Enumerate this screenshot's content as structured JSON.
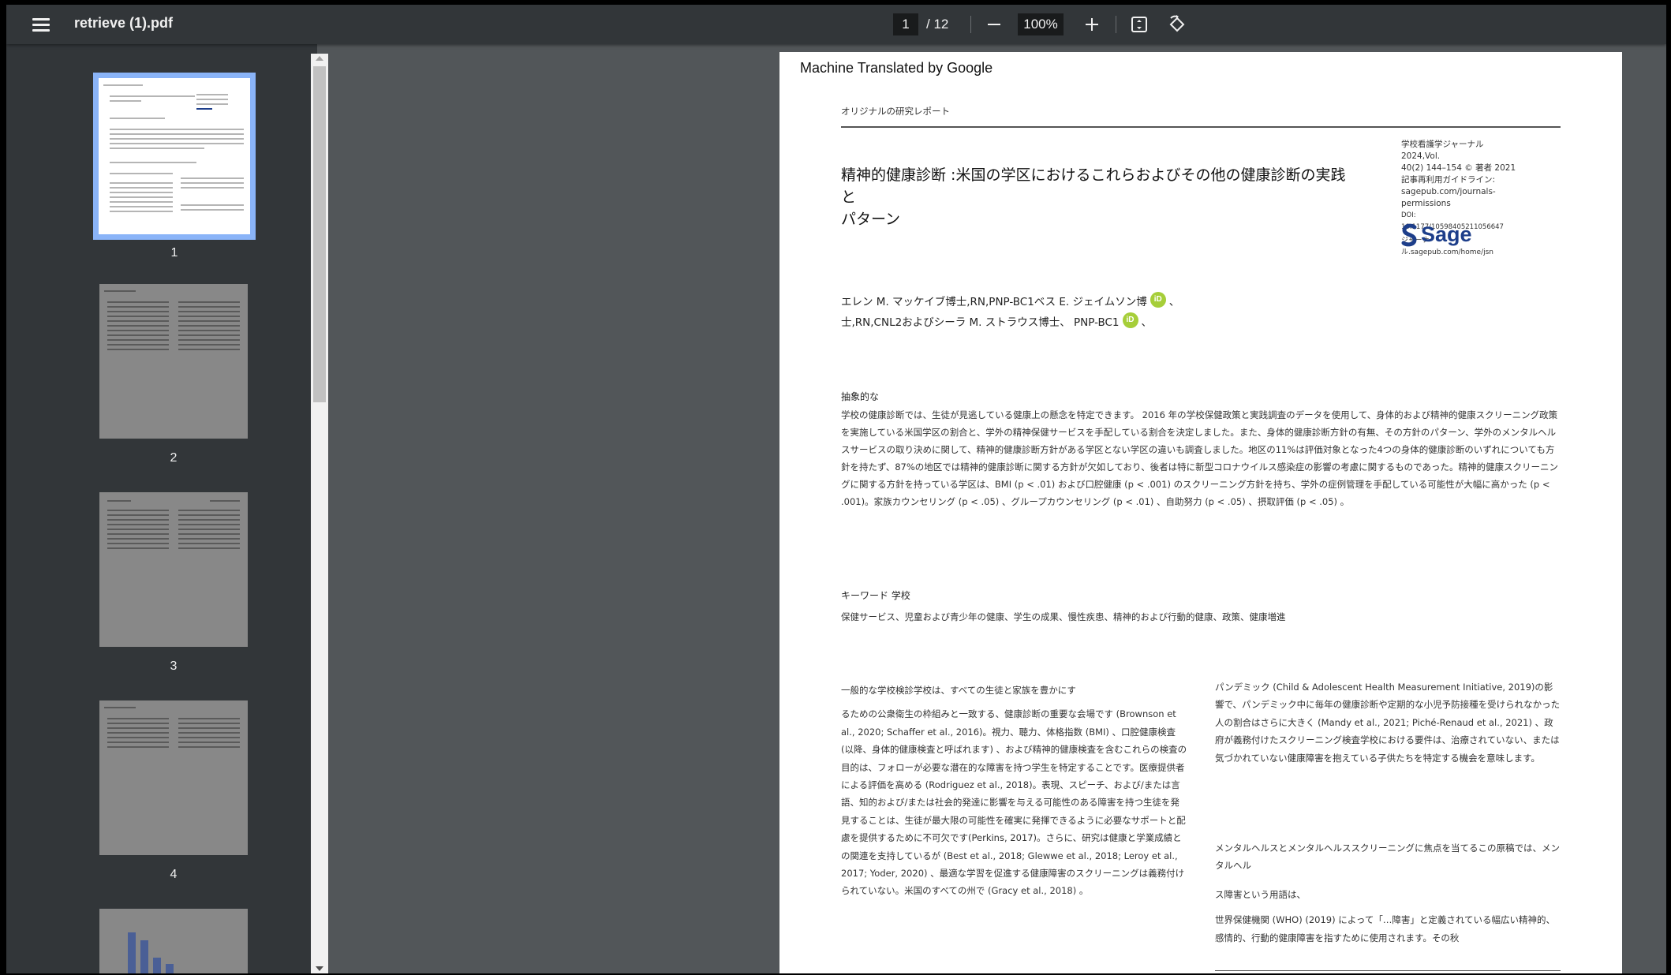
{
  "app": {
    "file_name": "retrieve (1).pdf",
    "current_page": "1",
    "total_pages": "/ 12",
    "zoom": "100%"
  },
  "icons": {
    "menu": "hamburger-menu-icon",
    "zoom_out": "minus-icon",
    "zoom_in": "plus-icon",
    "fit": "fit-to-page-icon",
    "rotate": "rotate-icon"
  },
  "sidebar": {
    "thumbnails": [
      {
        "label": "1"
      },
      {
        "label": "2"
      },
      {
        "label": "3"
      },
      {
        "label": "4"
      }
    ]
  },
  "document": {
    "banner": "Machine Translated by Google",
    "section_label": "オリジナルの研究レポート",
    "title_line1": "精神的健康診断 :米国の学区におけるこれらおよびその他の健康診断の実践と",
    "title_line2": "パターン",
    "journal_info": [
      "学校看護学ジャーナル2024,Vol.",
      "40(2) 144–154 © 著者 2021",
      "記事再利用ガイドライン:",
      "sagepub.com/journals-",
      "permissions"
    ],
    "doi": "DOI: 10.1177/10598405211056647",
    "journal_url": "ジャーナル.sagepub.com/home/jsn",
    "publisher": "Sage",
    "authors_line1": "エレン M. マッケイブ博士,RN,PNP-BC1ベス E. ジェイムソン博",
    "authors_line2": "士,RN,CNL2およびシーラ M. ストラウス博士、 PNP-BC1",
    "author_sep": "、",
    "orcid_label": "iD",
    "abstract_heading": "抽象的な",
    "abstract_text": "学校の健康診断では、生徒が見逃している健康上の懸念を特定できます。 2016 年の学校保健政策と実践調査のデータを使用して、身体的および精神的健康スクリーニング政策を実施している米国学区の割合と、学外の精神保健サービスを手配している割合を決定しました。また、身体的健康診断方針の有無、その方針のパターン、学外のメンタルヘルスサービスの取り決めに関して、精神的健康診断方針がある学区とない学区の違いも調査しました。地区の11%は評価対象となった4つの身体的健康診断のいずれについても方針を持たず、87%の地区では精神的健康診断に関する方針が欠如しており、後者は特に新型コロナウイルス感染症の影響の考慮に関するものであった。精神的健康スクリーニングに関する方針を持っている学区は、BMI (p < .01) および口腔健康 (p < .001) のスクリーニング方針を持ち、学外の症例管理を手配している可能性が大幅に高かった (p < .001)。家族カウンセリング (p < .05) 、グループカウンセリング (p < .01) 、自助努力 (p < .05) 、摂取評価 (p < .05) 。",
    "keywords_heading": "キーワード 学校",
    "keywords_text": "保健サービス、児童および青少年の健康、学生の成果、慢性疾患、精神的および行動的健康、政策、健康増進",
    "left_col_lead": "一般的な学校検診学校は、すべての生徒と家族を豊かにす",
    "left_col_body": "るための公衆衛生の枠組みと一致する、健康診断の重要な会場です (Brownson et al., 2020; Schaffer et al., 2016)。視力、聴力、体格指数 (BMI) 、口腔健康検査 (以降、身体的健康検査と呼ばれます) 、および精神的健康検査を含むこれらの検査の目的は、フォローが必要な潜在的な障害を持つ学生を特定することです。医療提供者による評価を高める (Rodriguez et al., 2018)。表現、スピーチ、および/または言語、知的および/または社会的発達に影響を与える可能性のある障害を持つ生徒を発見することは、生徒が最大限の可能性を確実に発揮できるように必要なサポートと配慮を提供するために不可欠です(Perkins, 2017)。さらに、研究は健康と学業成績との関連を支持しているが (Best et al., 2018; Glewwe et al., 2018; Leroy et al., 2017; Yoder, 2020) 、最適な学習を促進する健康障害のスクリーニングは義務付けられていない。米国のすべての州で (Gracy et al., 2018) 。",
    "right_col_p1": "パンデミック (Child & Adolescent Health Measurement Initiative, 2019)の影響で、パンデミック中に毎年の健康診断や定期的な小児予防接種を受けられなかった人の割合はさらに大きく (Mandy et al., 2021; Piché-Renaud et al., 2021) 、政府が義務付けたスクリーニング検査学校における要件は、治療されていない、または気づかれていない健康障害を抱えている子供たちを特定する機会を意味します。",
    "right_col_p2": "メンタルヘルスとメンタルヘルススクリーニングに焦点を当てるこの原稿では、メンタルヘル",
    "right_col_p2b": "ス障害という用語は、",
    "right_col_p3": "世界保健機関 (WHO) (2019) によって「…障害」と定義されている幅広い精神的、感情的、行動的健康障害を指すために使用されます。その秋"
  }
}
